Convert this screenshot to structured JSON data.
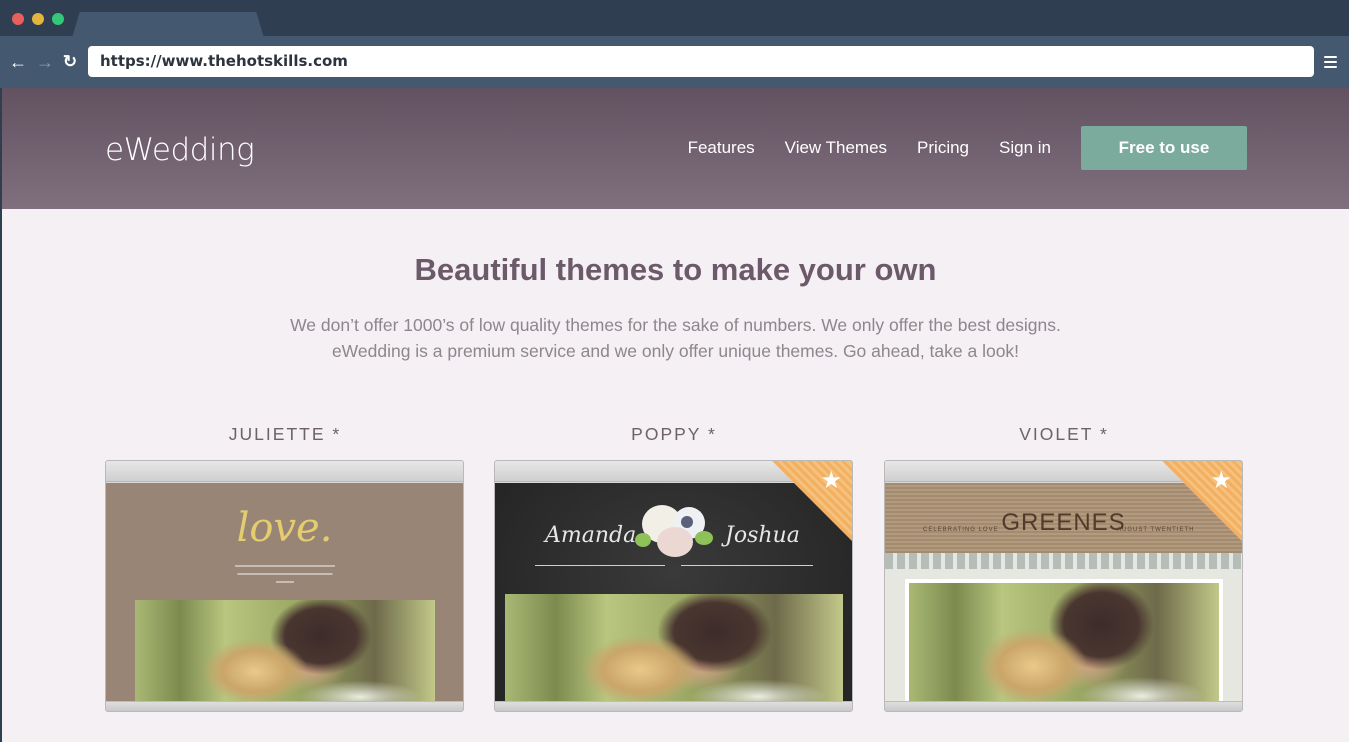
{
  "browser": {
    "url": "https://www.thehotskills.com",
    "back_icon": "←",
    "forward_icon": "→",
    "reload_icon": "↻"
  },
  "site": {
    "logo": "eWedding",
    "nav": [
      {
        "label": "Features"
      },
      {
        "label": "View Themes"
      },
      {
        "label": "Pricing"
      },
      {
        "label": "Sign in"
      }
    ],
    "cta_label": "Free to use"
  },
  "section": {
    "title": "Beautiful themes to make your own",
    "subtitle_line1": "We don’t offer 1000’s of low quality themes for the sake of numbers. We only offer the best designs.",
    "subtitle_line2": "eWedding is a premium service and we only offer unique themes. Go ahead, take a look!"
  },
  "themes": [
    {
      "name": "JULIETTE *",
      "preview_text": "love.",
      "featured": false
    },
    {
      "name": "POPPY *",
      "preview_names": [
        "Amanda",
        "Joshua"
      ],
      "featured": true
    },
    {
      "name": "VIOLET *",
      "preview_text": "GREENES",
      "preview_left": "CELEBRATING LOVE",
      "preview_right": "AUGUST TWENTIETH",
      "featured": true
    }
  ],
  "ribbon_icon": "★",
  "colors": {
    "hero_top": "#625261",
    "hero_bottom": "#80707f",
    "cta": "#7aab9d",
    "title": "#6c5a6a",
    "ribbon": "#f2b063"
  }
}
